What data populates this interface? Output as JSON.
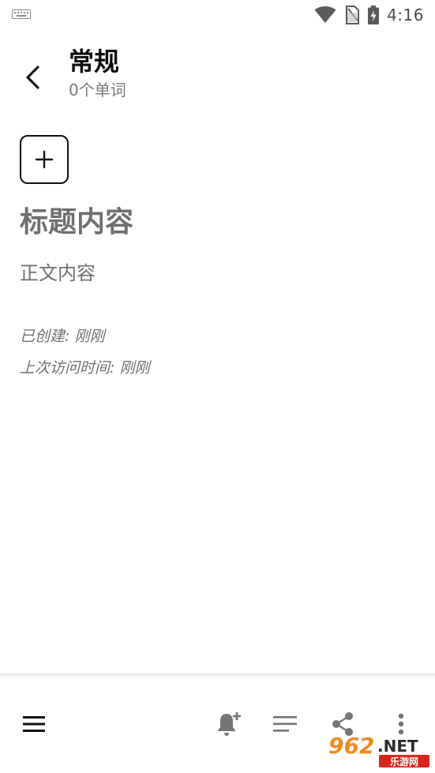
{
  "status_bar": {
    "time": "4:16",
    "icons": [
      "keyboard-icon",
      "wifi-icon",
      "no-sim-icon",
      "battery-charging-icon"
    ]
  },
  "header": {
    "title": "常规",
    "subtitle": "0个单词"
  },
  "note": {
    "title": "标题内容",
    "body": "正文内容",
    "created": "已创建: 刚刚",
    "accessed": "上次访问时间: 刚刚"
  },
  "bottom_bar": {
    "icons": [
      "menu-icon",
      "add-reminder-icon",
      "text-format-icon",
      "share-icon",
      "more-vert-icon"
    ]
  },
  "watermark": {
    "brand": "962.NET",
    "subtext": "乐游网"
  },
  "colors": {
    "text_primary": "#111111",
    "text_secondary": "#6f6f6f",
    "icon_gray": "#757575",
    "watermark_orange": "#f08a1c",
    "watermark_red": "#d9261c"
  }
}
